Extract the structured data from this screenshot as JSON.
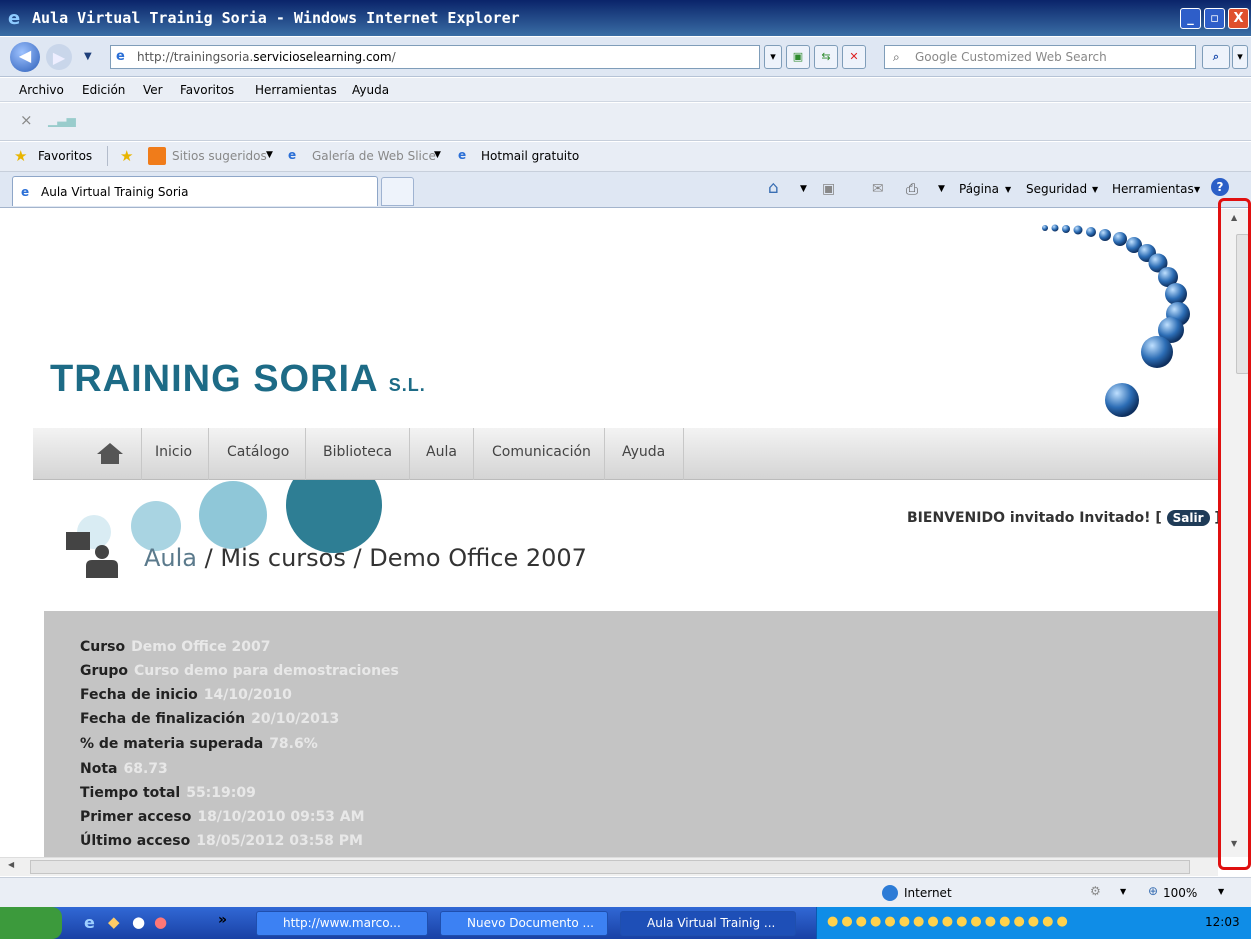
{
  "window": {
    "title": "Aula Virtual Trainig Soria - Windows Internet Explorer",
    "min": "_",
    "max": "▫",
    "close": "X"
  },
  "address": {
    "url_prefix": "http://trainingsoria.",
    "url_domain": "servicioselearning.com",
    "url_suffix": "/",
    "search_placeholder": "Google Customized Web Search"
  },
  "menu": [
    "Archivo",
    "Edición",
    "Ver",
    "Favoritos",
    "Herramientas",
    "Ayuda"
  ],
  "favorites": {
    "label": "Favoritos",
    "sitios": "Sitios sugeridos",
    "galeria": "Galería de Web Slice",
    "hotmail": "Hotmail gratuito"
  },
  "tab": {
    "title": "Aula Virtual Trainig Soria"
  },
  "commands": {
    "pagina": "Página",
    "seguridad": "Seguridad",
    "herramientas": "Herramientas"
  },
  "page": {
    "logo": "TRAINING SORIA",
    "logo_suffix": "S.L.",
    "nav": [
      "Inicio",
      "Catálogo",
      "Biblioteca",
      "Aula",
      "Comunicación",
      "Ayuda"
    ],
    "welcome": "BIENVENIDO invitado Invitado! [",
    "welcome_close": "]",
    "salir": "Salir",
    "breadcrumb": {
      "aula": "Aula",
      "sep": "/",
      "mis": "Mis cursos",
      "demo": "Demo Office 2007"
    },
    "details": [
      {
        "label": "Curso",
        "value": "Demo Office 2007"
      },
      {
        "label": "Grupo",
        "value": "Curso demo para demostraciones"
      },
      {
        "label": "Fecha de inicio",
        "value": "14/10/2010"
      },
      {
        "label": "Fecha de finalización",
        "value": "20/10/2013"
      },
      {
        "label": "% de materia superada",
        "value": "78.6%"
      },
      {
        "label": "Nota",
        "value": "68.73"
      },
      {
        "label": "Tiempo total",
        "value": "55:19:09"
      },
      {
        "label": "Primer acceso",
        "value": "18/10/2010 09:53 AM"
      },
      {
        "label": "Último acceso",
        "value": "18/05/2012 03:58 PM"
      }
    ]
  },
  "status": {
    "zone": "Internet",
    "zoom": "100%"
  },
  "taskbar": {
    "items": [
      "http://www.marco...",
      "Nuevo Documento ...",
      "Aula Virtual Trainig ..."
    ],
    "clock": "12:03",
    "chevron": "»"
  }
}
